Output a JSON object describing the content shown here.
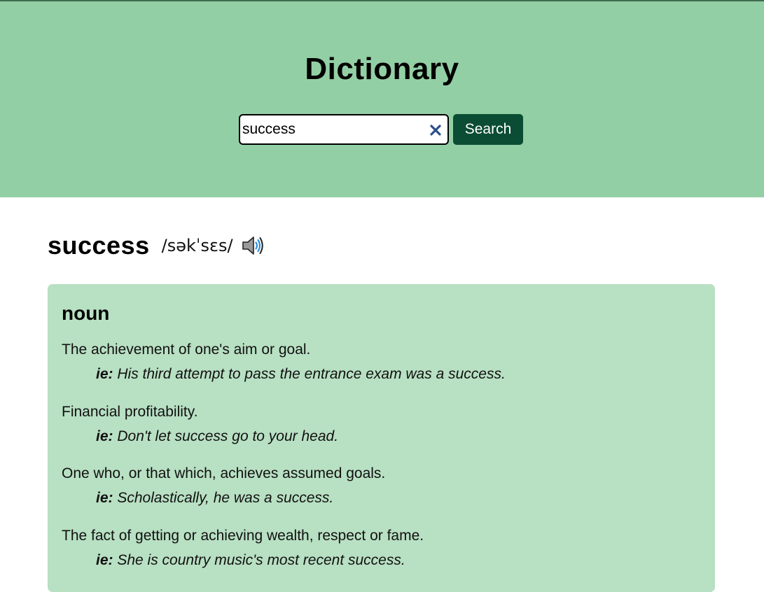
{
  "header": {
    "title": "Dictionary",
    "background": "#93cfa5"
  },
  "search": {
    "value": "success",
    "placeholder": "",
    "button_label": "Search",
    "button_color": "#0b4d34",
    "clear_icon": "close-icon"
  },
  "entry": {
    "word": "success",
    "phonetic": "/səkˈsɛs/",
    "audio_icon": "speaker-icon",
    "meanings": [
      {
        "part_of_speech": "noun",
        "card_color": "#b8e0c3",
        "definitions": [
          {
            "definition": "The achievement of one's aim or goal.",
            "example_prefix": "ie:",
            "example": "His third attempt to pass the entrance exam was a success."
          },
          {
            "definition": "Financial profitability.",
            "example_prefix": "ie:",
            "example": "Don't let success go to your head."
          },
          {
            "definition": "One who, or that which, achieves assumed goals.",
            "example_prefix": "ie:",
            "example": "Scholastically, he was a success."
          },
          {
            "definition": "The fact of getting or achieving wealth, respect or fame.",
            "example_prefix": "ie:",
            "example": "She is country music's most recent success."
          }
        ]
      }
    ]
  }
}
